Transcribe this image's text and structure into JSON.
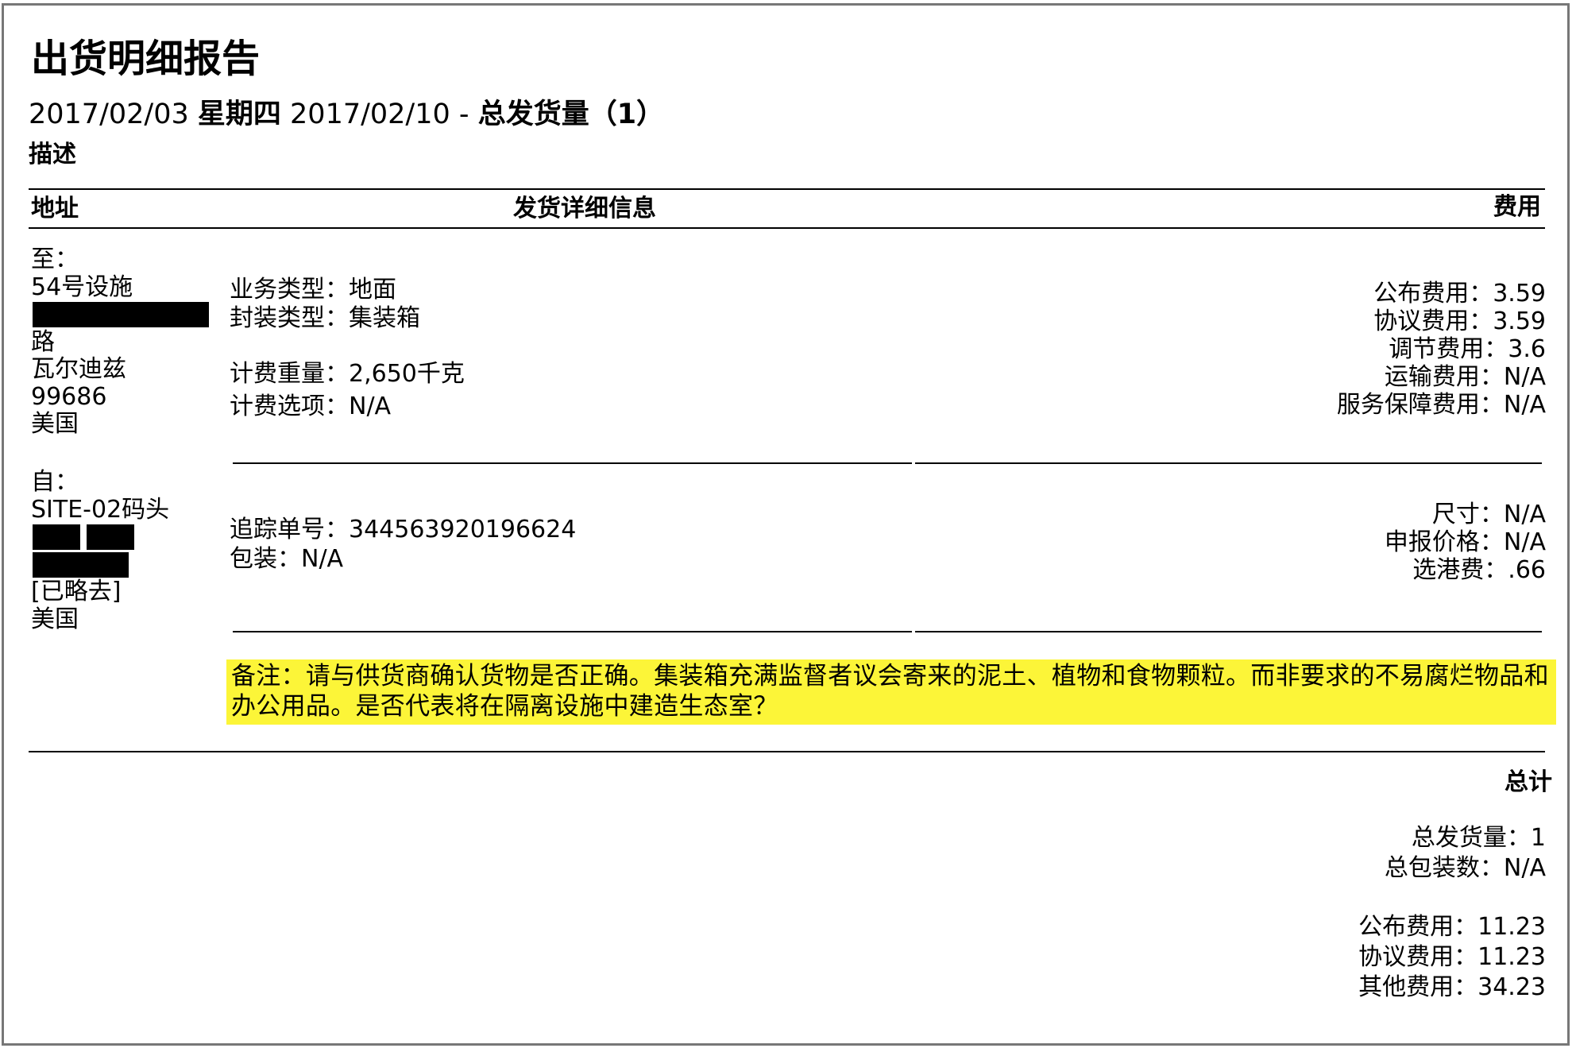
{
  "report": {
    "title": "出货明细报告",
    "date_start": "2017/02/03",
    "weekday": "星期四",
    "date_end": "2017/02/10",
    "dash": "-",
    "total_label": "总发货量（1）",
    "description_label": "描述"
  },
  "table_headers": {
    "address": "地址",
    "details": "发货详细信息",
    "fees": "费用"
  },
  "to_address": {
    "label": "至：",
    "line1": "54号设施",
    "line2": "路",
    "line3": "瓦尔迪兹",
    "line4": "99686",
    "line5": "美国"
  },
  "from_address": {
    "label": "自：",
    "line1": "SITE-02码头",
    "line2": "[已略去]",
    "line3": "美国"
  },
  "details_block1": {
    "service_type": "业务类型：地面",
    "package_type": "封装类型：集装箱",
    "billing_weight": "计费重量：2,650千克",
    "billing_option": "计费选项：N/A"
  },
  "details_block2": {
    "tracking_number": "追踪单号：344563920196624",
    "packaging": "包装：N/A"
  },
  "fees_block1": {
    "published_fee": "公布费用：3.59",
    "negotiated_fee": "协议费用：3.59",
    "adjusted_fee": "调节费用：3.6",
    "transport_fee": "运输费用：N/A",
    "service_guarantee_fee": "服务保障费用：N/A"
  },
  "fees_block2": {
    "dimensions": "尺寸：N/A",
    "declared_value": "申报价格：N/A",
    "port_fee": "选港费：.66"
  },
  "note": "备注：请与供货商确认货物是否正确。集装箱充满监督者议会寄来的泥土、植物和食物颗粒。而非要求的不易腐烂物品和办公用品。是否代表将在隔离设施中建造生态室？",
  "totals": {
    "heading": "总计",
    "total_shipments": "总发货量：1",
    "total_packages": "总包装数：N/A",
    "published_fee": "公布费用：11.23",
    "negotiated_fee": "协议费用：11.23",
    "other_fee": "其他费用：34.23"
  },
  "colors": {
    "note_highlight": "#fcf538",
    "border": "#777777"
  }
}
